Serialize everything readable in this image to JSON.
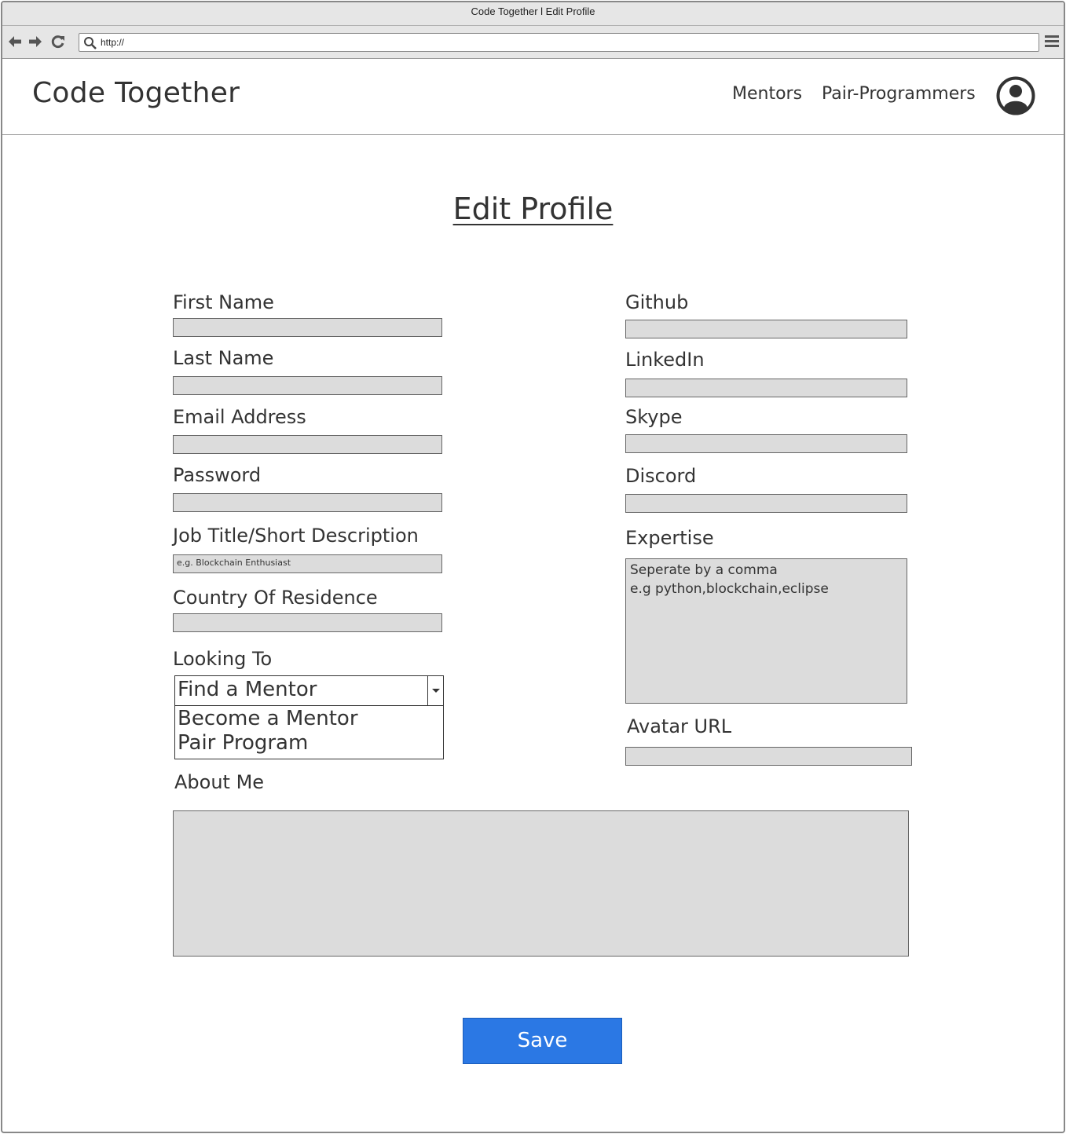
{
  "browser": {
    "window_title": "Code Together l Edit Profile",
    "url": "http://"
  },
  "header": {
    "brand": "Code Together",
    "nav": [
      "Mentors",
      "Pair-Programmers"
    ]
  },
  "page": {
    "title": "Edit Profile"
  },
  "form": {
    "first_name": {
      "label": "First Name"
    },
    "last_name": {
      "label": "Last Name"
    },
    "email": {
      "label": "Email Address"
    },
    "password": {
      "label": "Password"
    },
    "job_title": {
      "label": "Job Title/Short Description",
      "placeholder": "e.g. Blockchain Enthusiast"
    },
    "country": {
      "label": "Country Of Residence"
    },
    "looking_to": {
      "label": "Looking To",
      "selected": "Find a Mentor",
      "options": [
        "Become a Mentor",
        "Pair Program"
      ]
    },
    "about_me": {
      "label": "About Me"
    },
    "github": {
      "label": "Github"
    },
    "linkedin": {
      "label": "LinkedIn"
    },
    "skype": {
      "label": "Skype"
    },
    "discord": {
      "label": "Discord"
    },
    "expertise": {
      "label": "Expertise",
      "placeholder_line1": "Seperate by a comma",
      "placeholder_line2": "e.g python,blockchain,eclipse"
    },
    "avatar_url": {
      "label": "Avatar URL"
    }
  },
  "actions": {
    "save_label": "Save"
  },
  "colors": {
    "primary_button": "#2b78e4",
    "field_background": "#dcdcdc"
  }
}
